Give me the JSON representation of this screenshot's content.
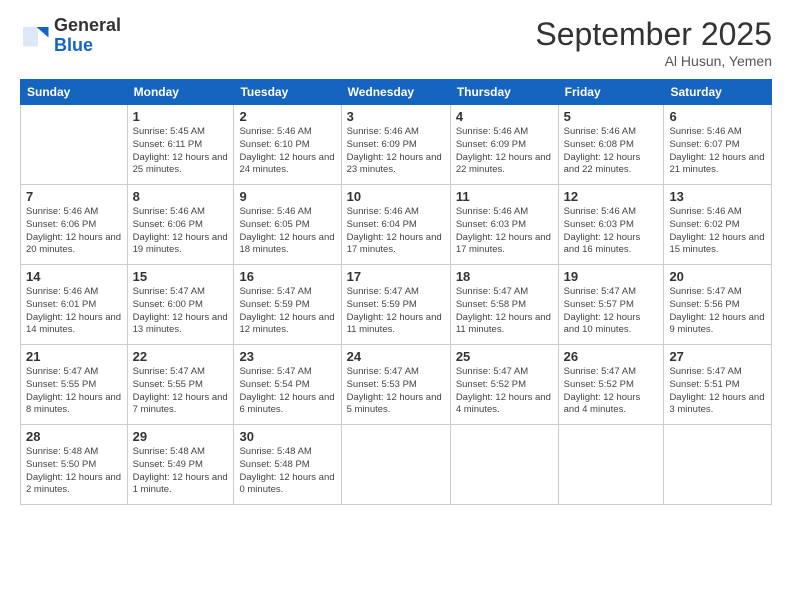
{
  "header": {
    "logo_general": "General",
    "logo_blue": "Blue",
    "month_title": "September 2025",
    "location": "Al Husun, Yemen"
  },
  "weekdays": [
    "Sunday",
    "Monday",
    "Tuesday",
    "Wednesday",
    "Thursday",
    "Friday",
    "Saturday"
  ],
  "weeks": [
    [
      {
        "day": "",
        "info": ""
      },
      {
        "day": "1",
        "info": "Sunrise: 5:45 AM\nSunset: 6:11 PM\nDaylight: 12 hours\nand 25 minutes."
      },
      {
        "day": "2",
        "info": "Sunrise: 5:46 AM\nSunset: 6:10 PM\nDaylight: 12 hours\nand 24 minutes."
      },
      {
        "day": "3",
        "info": "Sunrise: 5:46 AM\nSunset: 6:09 PM\nDaylight: 12 hours\nand 23 minutes."
      },
      {
        "day": "4",
        "info": "Sunrise: 5:46 AM\nSunset: 6:09 PM\nDaylight: 12 hours\nand 22 minutes."
      },
      {
        "day": "5",
        "info": "Sunrise: 5:46 AM\nSunset: 6:08 PM\nDaylight: 12 hours\nand 22 minutes."
      },
      {
        "day": "6",
        "info": "Sunrise: 5:46 AM\nSunset: 6:07 PM\nDaylight: 12 hours\nand 21 minutes."
      }
    ],
    [
      {
        "day": "7",
        "info": "Sunrise: 5:46 AM\nSunset: 6:06 PM\nDaylight: 12 hours\nand 20 minutes."
      },
      {
        "day": "8",
        "info": "Sunrise: 5:46 AM\nSunset: 6:06 PM\nDaylight: 12 hours\nand 19 minutes."
      },
      {
        "day": "9",
        "info": "Sunrise: 5:46 AM\nSunset: 6:05 PM\nDaylight: 12 hours\nand 18 minutes."
      },
      {
        "day": "10",
        "info": "Sunrise: 5:46 AM\nSunset: 6:04 PM\nDaylight: 12 hours\nand 17 minutes."
      },
      {
        "day": "11",
        "info": "Sunrise: 5:46 AM\nSunset: 6:03 PM\nDaylight: 12 hours\nand 17 minutes."
      },
      {
        "day": "12",
        "info": "Sunrise: 5:46 AM\nSunset: 6:03 PM\nDaylight: 12 hours\nand 16 minutes."
      },
      {
        "day": "13",
        "info": "Sunrise: 5:46 AM\nSunset: 6:02 PM\nDaylight: 12 hours\nand 15 minutes."
      }
    ],
    [
      {
        "day": "14",
        "info": "Sunrise: 5:46 AM\nSunset: 6:01 PM\nDaylight: 12 hours\nand 14 minutes."
      },
      {
        "day": "15",
        "info": "Sunrise: 5:47 AM\nSunset: 6:00 PM\nDaylight: 12 hours\nand 13 minutes."
      },
      {
        "day": "16",
        "info": "Sunrise: 5:47 AM\nSunset: 5:59 PM\nDaylight: 12 hours\nand 12 minutes."
      },
      {
        "day": "17",
        "info": "Sunrise: 5:47 AM\nSunset: 5:59 PM\nDaylight: 12 hours\nand 11 minutes."
      },
      {
        "day": "18",
        "info": "Sunrise: 5:47 AM\nSunset: 5:58 PM\nDaylight: 12 hours\nand 11 minutes."
      },
      {
        "day": "19",
        "info": "Sunrise: 5:47 AM\nSunset: 5:57 PM\nDaylight: 12 hours\nand 10 minutes."
      },
      {
        "day": "20",
        "info": "Sunrise: 5:47 AM\nSunset: 5:56 PM\nDaylight: 12 hours\nand 9 minutes."
      }
    ],
    [
      {
        "day": "21",
        "info": "Sunrise: 5:47 AM\nSunset: 5:55 PM\nDaylight: 12 hours\nand 8 minutes."
      },
      {
        "day": "22",
        "info": "Sunrise: 5:47 AM\nSunset: 5:55 PM\nDaylight: 12 hours\nand 7 minutes."
      },
      {
        "day": "23",
        "info": "Sunrise: 5:47 AM\nSunset: 5:54 PM\nDaylight: 12 hours\nand 6 minutes."
      },
      {
        "day": "24",
        "info": "Sunrise: 5:47 AM\nSunset: 5:53 PM\nDaylight: 12 hours\nand 5 minutes."
      },
      {
        "day": "25",
        "info": "Sunrise: 5:47 AM\nSunset: 5:52 PM\nDaylight: 12 hours\nand 4 minutes."
      },
      {
        "day": "26",
        "info": "Sunrise: 5:47 AM\nSunset: 5:52 PM\nDaylight: 12 hours\nand 4 minutes."
      },
      {
        "day": "27",
        "info": "Sunrise: 5:47 AM\nSunset: 5:51 PM\nDaylight: 12 hours\nand 3 minutes."
      }
    ],
    [
      {
        "day": "28",
        "info": "Sunrise: 5:48 AM\nSunset: 5:50 PM\nDaylight: 12 hours\nand 2 minutes."
      },
      {
        "day": "29",
        "info": "Sunrise: 5:48 AM\nSunset: 5:49 PM\nDaylight: 12 hours\nand 1 minute."
      },
      {
        "day": "30",
        "info": "Sunrise: 5:48 AM\nSunset: 5:48 PM\nDaylight: 12 hours\nand 0 minutes."
      },
      {
        "day": "",
        "info": ""
      },
      {
        "day": "",
        "info": ""
      },
      {
        "day": "",
        "info": ""
      },
      {
        "day": "",
        "info": ""
      }
    ]
  ]
}
